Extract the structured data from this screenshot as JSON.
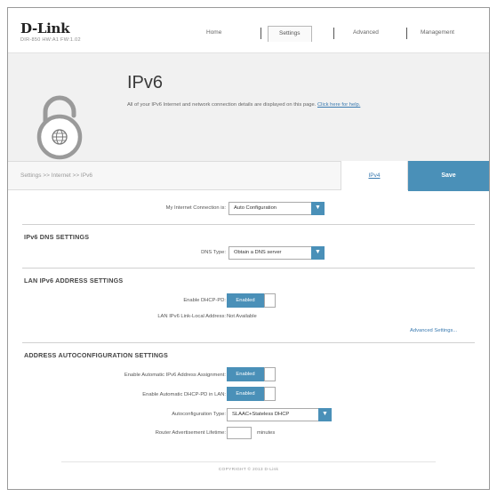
{
  "header": {
    "brand": "D-Link",
    "device_info": "DIR-850   HW:A1   FW:1.02",
    "nav": [
      {
        "label": "Home",
        "active": false
      },
      {
        "label": "Settings",
        "active": true
      },
      {
        "label": "Advanced",
        "active": false
      },
      {
        "label": "Management",
        "active": false
      }
    ]
  },
  "hero": {
    "title": "IPv6",
    "description": "All of your IPv6 Internet and network connection details are displayed on this page.",
    "help_link": "Click here for help.",
    "icon": "lock-globe-icon"
  },
  "toolbar": {
    "breadcrumb": "Settings >> Internet >> IPv6",
    "ipv4_link": "IPv4",
    "save_label": "Save"
  },
  "connection": {
    "label": "My Internet Connection is:",
    "value": "Auto Configuration"
  },
  "dns": {
    "section_title": "IPv6 DNS SETTINGS",
    "type_label": "DNS Type:",
    "type_value": "Obtain a DNS server"
  },
  "lan": {
    "section_title": "LAN IPv6 ADDRESS SETTINGS",
    "dhcp_pd_label": "Enable DHCP-PD:",
    "dhcp_pd_value": "Enabled",
    "link_local_label": "LAN IPv6 Link-Local Address:",
    "link_local_value": "Not Available",
    "advanced_link": "Advanced Settings..."
  },
  "autoconfig": {
    "section_title": "ADDRESS AUTOCONFIGURATION SETTINGS",
    "auto_assign_label": "Enable Automatic IPv6 Address Assignment:",
    "auto_assign_value": "Enabled",
    "auto_dhcp_pd_label": "Enable Automatic DHCP-PD in LAN:",
    "auto_dhcp_pd_value": "Enabled",
    "type_label": "Autoconfiguration Type:",
    "type_value": "SLAAC+Stateless DHCP",
    "lifetime_label": "Router Advertisement Lifetime:",
    "lifetime_value": "",
    "lifetime_unit": "minutes"
  },
  "footer": {
    "copyright": "COPYRIGHT © 2013 D-Link"
  },
  "colors": {
    "accent": "#4a90b8",
    "link": "#3a7ab0",
    "hero_bg": "#f1f1f1"
  }
}
